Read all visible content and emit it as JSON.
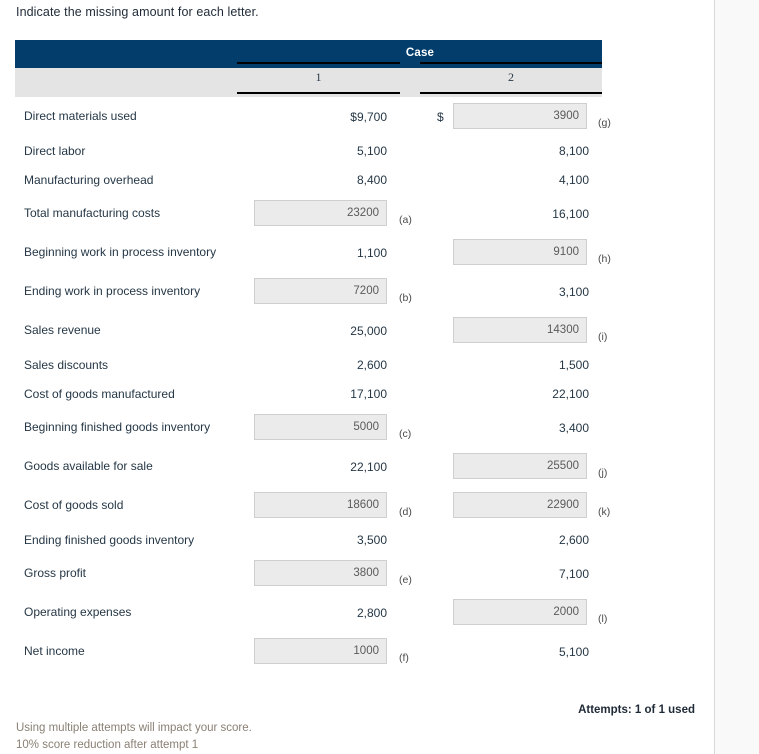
{
  "prompt": "Indicate the missing amount for each letter.",
  "table": {
    "header_group": "Case",
    "columns": [
      "1",
      "2"
    ],
    "rows": [
      {
        "label": "Direct materials used",
        "c1": {
          "kind": "value",
          "text": "$9,700"
        },
        "c2": {
          "kind": "input",
          "prefix": "$",
          "value": "3900",
          "letter": "(g)"
        }
      },
      {
        "label": "Direct labor",
        "c1": {
          "kind": "value",
          "text": "5,100"
        },
        "c2": {
          "kind": "value",
          "text": "8,100"
        }
      },
      {
        "label": "Manufacturing overhead",
        "c1": {
          "kind": "value",
          "text": "8,400"
        },
        "c2": {
          "kind": "value",
          "text": "4,100"
        }
      },
      {
        "label": "Total manufacturing costs",
        "c1": {
          "kind": "input",
          "prefix": "",
          "value": "23200",
          "letter": "(a)"
        },
        "c2": {
          "kind": "value",
          "text": "16,100"
        }
      },
      {
        "label": "Beginning work in process inventory",
        "c1": {
          "kind": "value",
          "text": "1,100"
        },
        "c2": {
          "kind": "input",
          "prefix": "",
          "value": "9100",
          "letter": "(h)"
        }
      },
      {
        "label": "Ending work in process inventory",
        "c1": {
          "kind": "input",
          "prefix": "",
          "value": "7200",
          "letter": "(b)"
        },
        "c2": {
          "kind": "value",
          "text": "3,100"
        }
      },
      {
        "label": "Sales revenue",
        "c1": {
          "kind": "value",
          "text": "25,000"
        },
        "c2": {
          "kind": "input",
          "prefix": "",
          "value": "14300",
          "letter": "(i)"
        }
      },
      {
        "label": "Sales discounts",
        "c1": {
          "kind": "value",
          "text": "2,600"
        },
        "c2": {
          "kind": "value",
          "text": "1,500"
        }
      },
      {
        "label": "Cost of goods manufactured",
        "c1": {
          "kind": "value",
          "text": "17,100"
        },
        "c2": {
          "kind": "value",
          "text": "22,100"
        }
      },
      {
        "label": "Beginning finished goods inventory",
        "c1": {
          "kind": "input",
          "prefix": "",
          "value": "5000",
          "letter": "(c)"
        },
        "c2": {
          "kind": "value",
          "text": "3,400"
        }
      },
      {
        "label": "Goods available for sale",
        "c1": {
          "kind": "value",
          "text": "22,100"
        },
        "c2": {
          "kind": "input",
          "prefix": "",
          "value": "25500",
          "letter": "(j)"
        }
      },
      {
        "label": "Cost of goods sold",
        "c1": {
          "kind": "input",
          "prefix": "",
          "value": "18600",
          "letter": "(d)"
        },
        "c2": {
          "kind": "input",
          "prefix": "",
          "value": "22900",
          "letter": "(k)"
        }
      },
      {
        "label": "Ending finished goods inventory",
        "c1": {
          "kind": "value",
          "text": "3,500"
        },
        "c2": {
          "kind": "value",
          "text": "2,600"
        }
      },
      {
        "label": "Gross profit",
        "c1": {
          "kind": "input",
          "prefix": "",
          "value": "3800",
          "letter": "(e)"
        },
        "c2": {
          "kind": "value",
          "text": "7,100"
        }
      },
      {
        "label": "Operating expenses",
        "c1": {
          "kind": "value",
          "text": "2,800"
        },
        "c2": {
          "kind": "input",
          "prefix": "",
          "value": "2000",
          "letter": "(l)"
        }
      },
      {
        "label": "Net income",
        "c1": {
          "kind": "input",
          "prefix": "",
          "value": "1000",
          "letter": "(f)"
        },
        "c2": {
          "kind": "value",
          "text": "5,100"
        }
      }
    ]
  },
  "footer": {
    "attempts": "Attempts: 1 of 1 used",
    "note_line1": "Using multiple attempts will impact your score.",
    "note_line2": "10% score reduction after attempt 1"
  },
  "colors": {
    "header_bar": "#023d6b",
    "subheader_bar": "#e4e4e4",
    "input_fill": "#ebebeb",
    "input_border": "#cfcfcf",
    "text": "#253746",
    "note_text": "#8a8074"
  }
}
